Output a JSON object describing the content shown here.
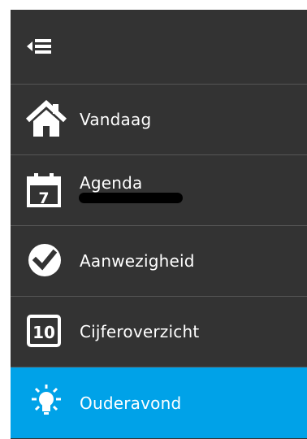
{
  "nav": {
    "collapse_icon": "collapse-menu-icon",
    "items": [
      {
        "label": "Vandaag",
        "icon": "home-icon",
        "active": false
      },
      {
        "label": "Agenda",
        "icon": "calendar-icon",
        "calendar_day": "7",
        "active": false
      },
      {
        "label": "Aanwezigheid",
        "icon": "checkmark-circle-icon",
        "active": false
      },
      {
        "label": "Cijferoverzicht",
        "icon": "grade-icon",
        "grade_number": "10",
        "active": false
      },
      {
        "label": "Ouderavond",
        "icon": "lightbulb-icon",
        "active": true
      }
    ]
  },
  "colors": {
    "panel_background": "#333333",
    "divider": "#555555",
    "active_background": "#00a2e8",
    "text": "#ffffff"
  }
}
